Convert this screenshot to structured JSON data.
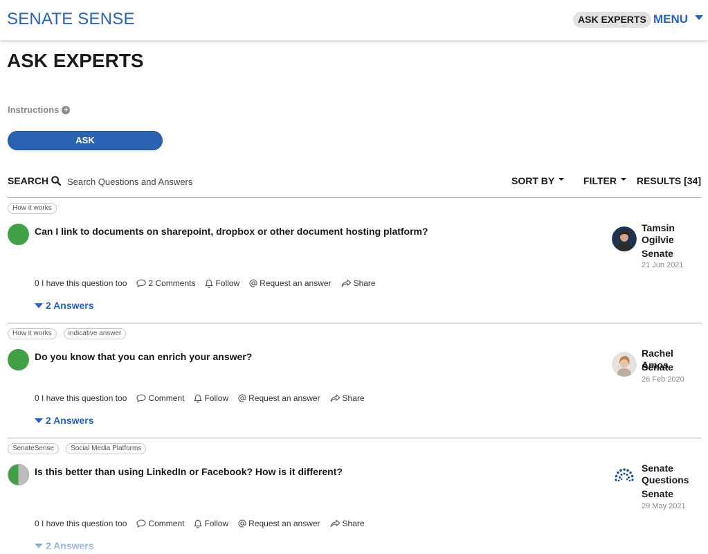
{
  "header": {
    "brand": "SENATE SENSE",
    "nav_pill": "ASK EXPERTS",
    "menu_label": "MENU"
  },
  "page": {
    "title": "ASK EXPERTS",
    "instructions_label": "Instructions",
    "ask_button": "ASK"
  },
  "search": {
    "label": "SEARCH",
    "placeholder": "Search Questions and Answers",
    "sort_label": "SORT BY",
    "filter_label": "FILTER",
    "results_label": "RESULTS [34]"
  },
  "colors": {
    "brand_blue": "#2a63b1",
    "status_green": "#41a046",
    "status_grey": "#bdbdbd"
  },
  "questions": [
    {
      "tags": [
        "How it works"
      ],
      "status": "answered",
      "title": "Can I link to documents on sharepoint, dropbox or other document hosting platform?",
      "have_too": "0 I have this question too",
      "comments": "2 Comments",
      "follow": "Follow",
      "request": "Request an answer",
      "share": "Share",
      "answers": "2 Answers",
      "author_name": "Tamsin Ogilvie",
      "author_org": "Senate",
      "date": "21 Jun 2021",
      "avatar_icon": "person-photo-dark"
    },
    {
      "tags": [
        "How it works",
        "indicative answer"
      ],
      "status": "answered",
      "title": "Do you know that you can enrich your answer?",
      "have_too": "0 I have this question too",
      "comments": "Comment",
      "follow": "Follow",
      "request": "Request an answer",
      "share": "Share",
      "answers": "2 Answers",
      "author_name": "Rachel Amos",
      "author_org": "Senate",
      "date": "26 Feb 2020",
      "avatar_icon": "person-photo-light"
    },
    {
      "tags": [
        "SenateSense",
        "Social Media Platforms"
      ],
      "status": "partial",
      "title": "Is this better than using LinkedIn or Facebook? How is it different?",
      "have_too": "0 I have this question too",
      "comments": "Comment",
      "follow": "Follow",
      "request": "Request an answer",
      "share": "Share",
      "answers": "2 Answers",
      "author_name": "Senate Questions",
      "author_org": "Senate",
      "date": "29 May 2021",
      "avatar_icon": "senate-dots-logo"
    }
  ]
}
